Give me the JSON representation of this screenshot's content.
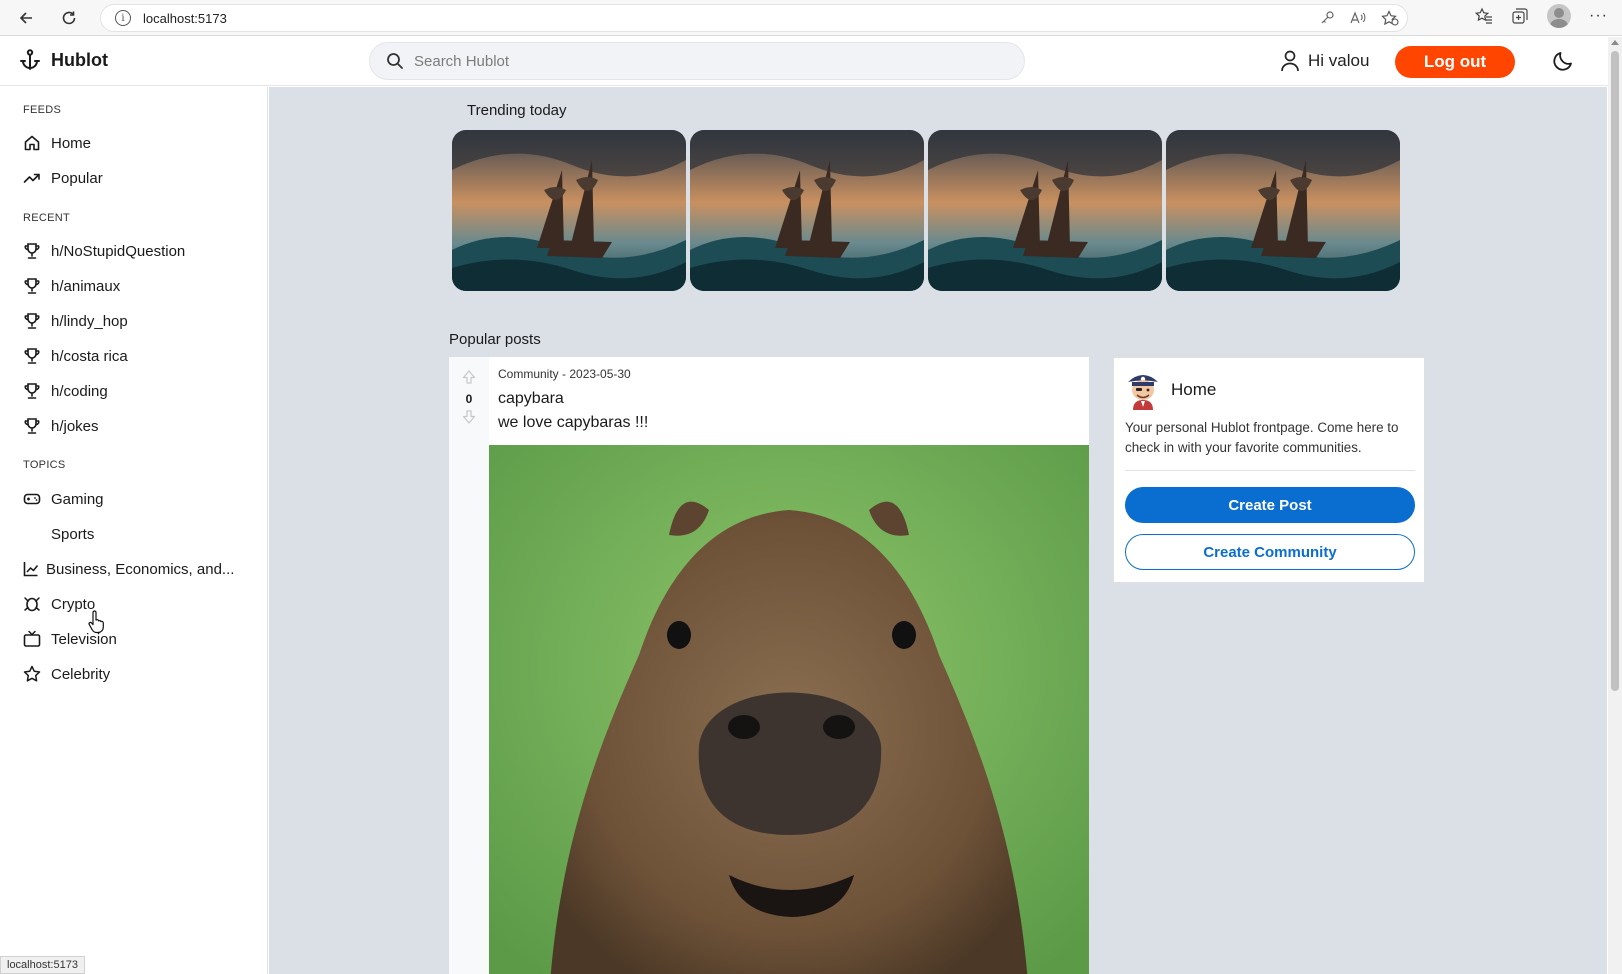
{
  "browser": {
    "url": "localhost:5173",
    "status_url": "localhost:5173"
  },
  "header": {
    "app_name": "Hublot",
    "search_placeholder": "Search Hublot",
    "greeting": "Hi valou",
    "logout_label": "Log out"
  },
  "sidebar": {
    "feeds_title": "FEEDS",
    "feeds": [
      {
        "label": "Home",
        "icon": "home-icon"
      },
      {
        "label": "Popular",
        "icon": "trending-icon"
      }
    ],
    "recent_title": "RECENT",
    "recent": [
      {
        "label": "h/NoStupidQuestion",
        "icon": "trophy-icon"
      },
      {
        "label": "h/animaux",
        "icon": "trophy-icon"
      },
      {
        "label": "h/lindy_hop",
        "icon": "trophy-icon"
      },
      {
        "label": "h/costa rica",
        "icon": "trophy-icon"
      },
      {
        "label": "h/coding",
        "icon": "trophy-icon"
      },
      {
        "label": "h/jokes",
        "icon": "trophy-icon"
      }
    ],
    "topics_title": "TOPICS",
    "topics": [
      {
        "label": "Gaming",
        "icon": "gamepad-icon"
      },
      {
        "label": "Sports",
        "icon": "ball-icon"
      },
      {
        "label": "Business, Economics, and...",
        "icon": "chart-icon"
      },
      {
        "label": "Crypto",
        "icon": "bug-icon"
      },
      {
        "label": "Television",
        "icon": "tv-icon"
      },
      {
        "label": "Celebrity",
        "icon": "star-icon"
      }
    ]
  },
  "main": {
    "trending_title": "Trending today",
    "trending_count": 4,
    "popular_title": "Popular posts",
    "post": {
      "votes": "0",
      "meta": "Community - 2023-05-30",
      "title": "capybara",
      "body": "we love capybaras !!!"
    },
    "side_card": {
      "title": "Home",
      "description": "Your personal Hublot frontpage. Come here to check in with your favorite communities.",
      "create_post_label": "Create Post",
      "create_community_label": "Create Community"
    }
  },
  "colors": {
    "accent": "#ff4500",
    "primary": "#0a6ed1",
    "main_bg": "#dae0e6"
  }
}
